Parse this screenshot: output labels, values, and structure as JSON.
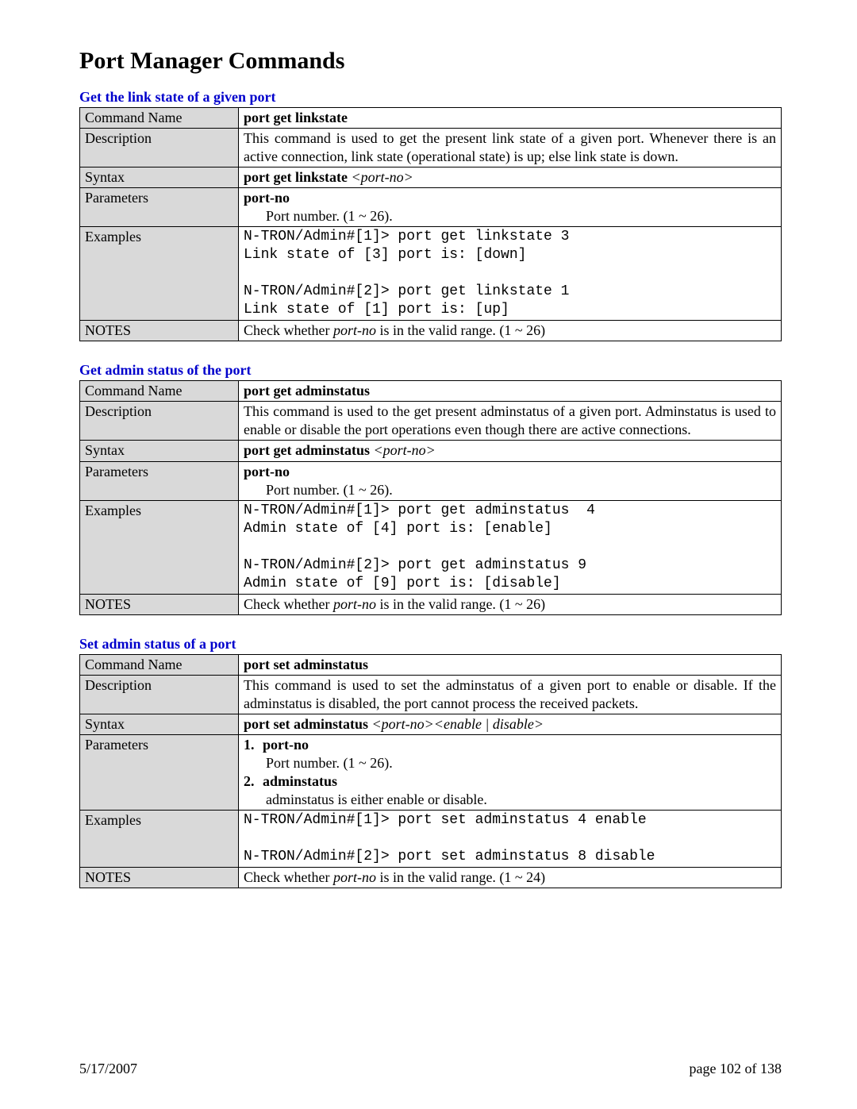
{
  "title": "Port Manager Commands",
  "row_labels": {
    "command_name": "Command Name",
    "description": "Description",
    "syntax": "Syntax",
    "parameters": "Parameters",
    "examples": "Examples",
    "notes": "NOTES"
  },
  "sections": [
    {
      "heading": "Get the link state of a given port",
      "command_name": "port get linkstate",
      "description": "This command is used to get the present link state of a given port. Whenever there is an active connection, link state (operational state) is up; else link state is down.",
      "syntax_prefix": "port get linkstate  ",
      "syntax_arg": "<port-no>",
      "param_name": "port-no",
      "param_desc": "Port number. (1 ~ 26).",
      "examples": "N-TRON/Admin#[1]> port get linkstate 3\nLink state of [3] port is: [down]\n\nN-TRON/Admin#[2]> port get linkstate 1\nLink state of [1] port is: [up]",
      "notes_pre": "Check whether ",
      "notes_em": "port-no",
      "notes_post": " is in the valid range. (1 ~ 26)"
    },
    {
      "heading": "Get admin status of the port",
      "command_name": "port get adminstatus",
      "description": "This command is used to the get present adminstatus of a given port. Adminstatus is used to enable or disable the port operations even though there are active connections.",
      "syntax_prefix": "port get adminstatus  ",
      "syntax_arg": "<port-no>",
      "param_name": "port-no",
      "param_desc": "Port number. (1 ~ 26).",
      "examples": "N-TRON/Admin#[1]> port get adminstatus  4\nAdmin state of [4] port is: [enable]\n\nN-TRON/Admin#[2]> port get adminstatus 9\nAdmin state of [9] port is: [disable]",
      "notes_pre": "Check whether ",
      "notes_em": "port-no",
      "notes_post": " is in the valid range. (1 ~ 26)"
    },
    {
      "heading": "Set admin status of a port",
      "command_name": "port set adminstatus",
      "description": "This command is used to set the adminstatus of a given port to enable or disable. If the adminstatus is disabled, the port cannot process the received packets.",
      "syntax_prefix": "port set adminstatus  ",
      "syntax_arg": "<port-no><enable | disable>",
      "params_list": [
        {
          "num": "1.",
          "term": "port-no",
          "desc": "Port number. (1 ~ 26)."
        },
        {
          "num": "2.",
          "term": "adminstatus",
          "desc": "adminstatus is either enable or disable."
        }
      ],
      "examples": "N-TRON/Admin#[1]> port set adminstatus 4 enable\n\nN-TRON/Admin#[2]> port set adminstatus 8 disable",
      "notes_pre": "Check whether ",
      "notes_em": "port-no",
      "notes_post": " is in the valid range. (1 ~ 24)"
    }
  ],
  "footer": {
    "date": "5/17/2007",
    "page": "page 102 of 138"
  }
}
